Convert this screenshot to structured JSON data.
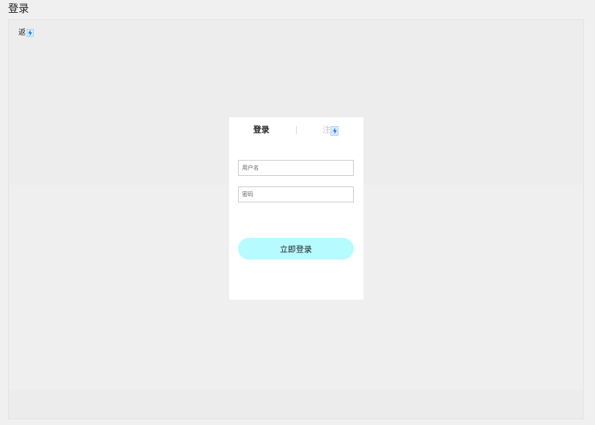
{
  "window": {
    "title": "登录"
  },
  "back": {
    "label": "返",
    "badge_icon": "bolt-icon"
  },
  "tabs": [
    {
      "label": "登录",
      "active": true
    },
    {
      "label": "注",
      "active": false,
      "badge_icon": "bolt-icon"
    }
  ],
  "form": {
    "username_placeholder": "用户名",
    "username_value": "",
    "password_placeholder": "密码",
    "password_value": "",
    "submit_label": "立即登录"
  },
  "colors": {
    "background": "#f0f0f0",
    "card": "#ffffff",
    "submit_button": "#b5fbff",
    "inactive_tab": "#c6c6c6",
    "badge": "#d8ecff",
    "bolt": "#1a73e8"
  }
}
